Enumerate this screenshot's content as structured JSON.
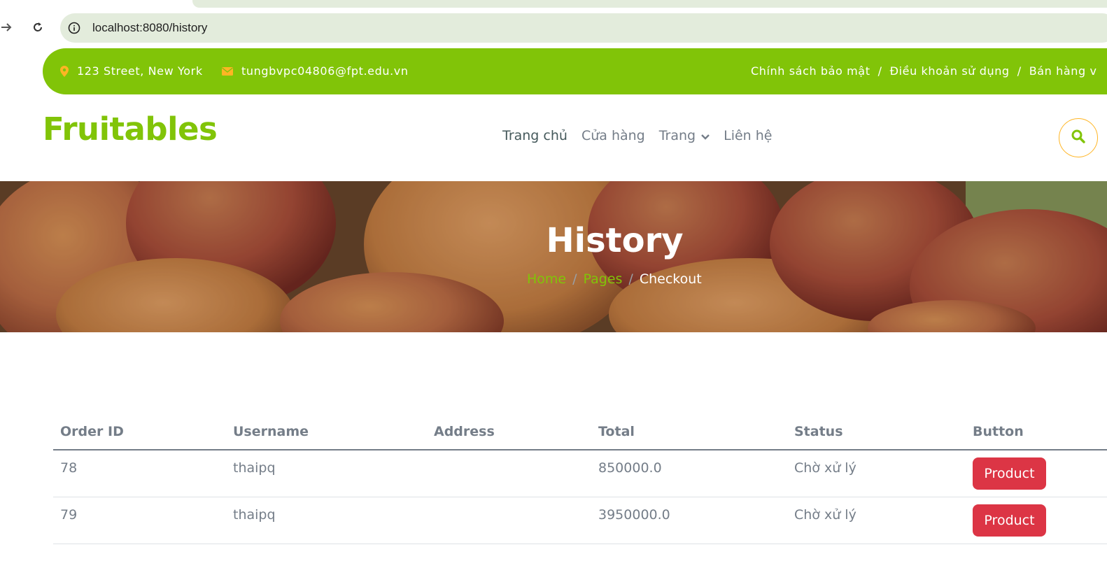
{
  "browser": {
    "url": "localhost:8080/history"
  },
  "topbar": {
    "address": "123 Street, New York",
    "email": "tungbvpc04806@fpt.edu.vn",
    "links": [
      "Chính sách bảo mật",
      "Điều khoản sử dụng",
      "Bán hàng v"
    ],
    "separator": "/"
  },
  "navbar": {
    "brand": "Fruitables",
    "menu": [
      "Trang chủ",
      "Cửa hàng",
      "Trang",
      "Liên hệ"
    ]
  },
  "hero": {
    "title": "History",
    "breadcrumb": [
      "Home",
      "Pages",
      "Checkout"
    ],
    "breadcrumb_separator": "/"
  },
  "table": {
    "headers": [
      "Order ID",
      "Username",
      "Address",
      "Total",
      "Status",
      "Button"
    ],
    "rows": [
      {
        "order_id": "78",
        "username": "thaipq",
        "address": "",
        "total": "850000.0",
        "status": "Chờ xử lý",
        "button": "Product"
      },
      {
        "order_id": "79",
        "username": "thaipq",
        "address": "",
        "total": "3950000.0",
        "status": "Chờ xử lý",
        "button": "Product"
      }
    ]
  },
  "colors": {
    "primary_green": "#81c408",
    "accent_yellow": "#ffb524",
    "danger_red": "#dc3545",
    "text_muted": "#747d88",
    "text_dark": "#45595b"
  },
  "icons": [
    "arrow-forward-icon",
    "reload-icon",
    "info-icon",
    "map-marker-icon",
    "envelope-icon",
    "chevron-down-icon",
    "search-icon"
  ]
}
